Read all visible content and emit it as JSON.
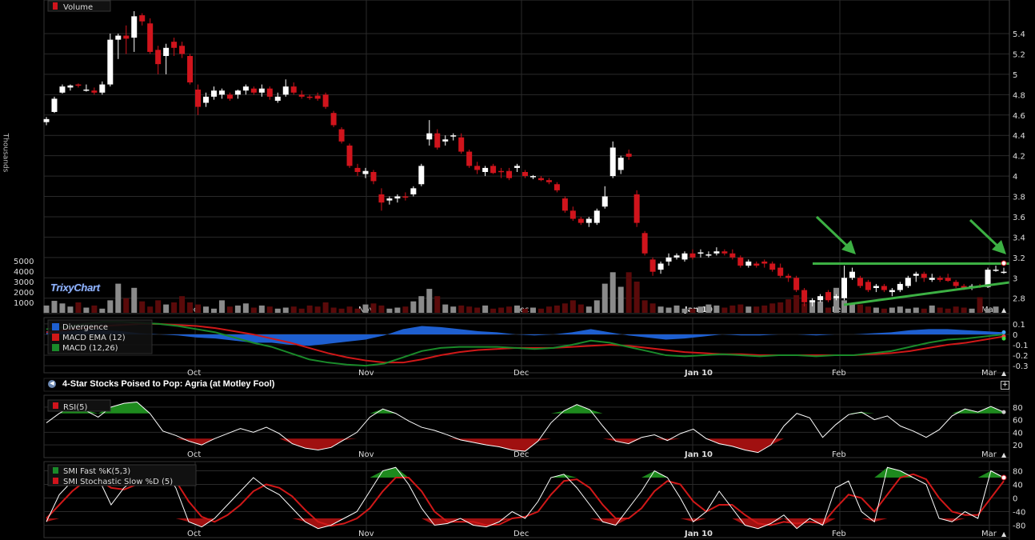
{
  "chart_data": [
    {
      "type": "candlestick",
      "legend": [
        "Volume"
      ],
      "y_ticks": [
        "2.8",
        "3",
        "3.2",
        "3.4",
        "3.6",
        "3.8",
        "4",
        "4.2",
        "4.4",
        "4.6",
        "4.8",
        "5",
        "5.2",
        "5.4"
      ],
      "ylim": [
        2.68,
        5.62
      ],
      "x_labels": [
        "Oct",
        "Nov",
        "Dec",
        "Jan 10",
        "Feb",
        "Mar"
      ],
      "ohlc": [
        [
          4.53,
          4.58,
          4.5,
          4.56
        ],
        [
          4.63,
          4.78,
          4.62,
          4.76
        ],
        [
          4.82,
          4.9,
          4.81,
          4.88
        ],
        [
          4.87,
          4.9,
          4.84,
          4.89
        ],
        [
          4.9,
          4.91,
          4.87,
          4.89
        ],
        [
          4.85,
          4.9,
          4.83,
          4.85
        ],
        [
          4.84,
          4.87,
          4.8,
          4.82
        ],
        [
          4.82,
          4.93,
          4.8,
          4.9
        ],
        [
          4.9,
          5.4,
          4.88,
          5.34
        ],
        [
          5.34,
          5.4,
          5.15,
          5.38
        ],
        [
          5.38,
          5.48,
          5.2,
          5.35
        ],
        [
          5.36,
          5.62,
          5.22,
          5.57
        ],
        [
          5.58,
          5.6,
          5.48,
          5.52
        ],
        [
          5.5,
          5.55,
          5.2,
          5.22
        ],
        [
          5.24,
          5.28,
          5.0,
          5.1
        ],
        [
          5.18,
          5.3,
          5.0,
          5.26
        ],
        [
          5.32,
          5.36,
          5.18,
          5.26
        ],
        [
          5.28,
          5.32,
          5.16,
          5.2
        ],
        [
          5.18,
          5.2,
          4.9,
          4.92
        ],
        [
          4.85,
          4.9,
          4.6,
          4.68
        ],
        [
          4.72,
          4.82,
          4.68,
          4.78
        ],
        [
          4.78,
          4.88,
          4.75,
          4.84
        ],
        [
          4.8,
          4.86,
          4.76,
          4.84
        ],
        [
          4.8,
          4.82,
          4.74,
          4.76
        ],
        [
          4.8,
          4.85,
          4.76,
          4.84
        ],
        [
          4.84,
          4.9,
          4.8,
          4.88
        ],
        [
          4.86,
          4.88,
          4.8,
          4.82
        ],
        [
          4.82,
          4.9,
          4.78,
          4.86
        ],
        [
          4.86,
          4.88,
          4.75,
          4.78
        ],
        [
          4.74,
          4.82,
          4.72,
          4.78
        ],
        [
          4.8,
          4.95,
          4.78,
          4.88
        ],
        [
          4.88,
          4.92,
          4.8,
          4.82
        ],
        [
          4.8,
          4.84,
          4.76,
          4.78
        ],
        [
          4.78,
          4.8,
          4.75,
          4.77
        ],
        [
          4.79,
          4.82,
          4.74,
          4.76
        ],
        [
          4.8,
          4.82,
          4.66,
          4.68
        ],
        [
          4.62,
          4.64,
          4.48,
          4.5
        ],
        [
          4.46,
          4.48,
          4.32,
          4.34
        ],
        [
          4.3,
          4.32,
          4.08,
          4.1
        ],
        [
          4.08,
          4.12,
          4.0,
          4.04
        ],
        [
          4.02,
          4.08,
          3.98,
          4.05
        ],
        [
          4.04,
          4.06,
          3.92,
          3.95
        ],
        [
          3.82,
          3.88,
          3.66,
          3.74
        ],
        [
          3.76,
          3.8,
          3.72,
          3.78
        ],
        [
          3.78,
          3.82,
          3.74,
          3.8
        ],
        [
          3.8,
          3.84,
          3.76,
          3.79
        ],
        [
          3.82,
          3.9,
          3.8,
          3.88
        ],
        [
          3.92,
          4.12,
          3.9,
          4.1
        ],
        [
          4.36,
          4.55,
          4.3,
          4.42
        ],
        [
          4.42,
          4.46,
          4.26,
          4.28
        ],
        [
          4.34,
          4.4,
          4.3,
          4.36
        ],
        [
          4.4,
          4.42,
          4.35,
          4.4
        ],
        [
          4.38,
          4.42,
          4.22,
          4.24
        ],
        [
          4.24,
          4.26,
          4.08,
          4.1
        ],
        [
          4.1,
          4.14,
          4.02,
          4.06
        ],
        [
          4.04,
          4.1,
          4.0,
          4.08
        ],
        [
          4.1,
          4.12,
          4.02,
          4.03
        ],
        [
          4.05,
          4.08,
          3.98,
          4.04
        ],
        [
          4.05,
          4.08,
          3.96,
          3.98
        ],
        [
          4.08,
          4.12,
          4.04,
          4.1
        ],
        [
          4.04,
          4.06,
          3.98,
          4.0
        ],
        [
          3.99,
          4.01,
          3.97,
          4.0
        ],
        [
          3.98,
          4.0,
          3.95,
          3.96
        ],
        [
          3.96,
          3.98,
          3.92,
          3.94
        ],
        [
          3.92,
          3.94,
          3.84,
          3.86
        ],
        [
          3.78,
          3.8,
          3.64,
          3.66
        ],
        [
          3.66,
          3.7,
          3.56,
          3.58
        ],
        [
          3.58,
          3.6,
          3.52,
          3.54
        ],
        [
          3.54,
          3.6,
          3.5,
          3.58
        ],
        [
          3.54,
          3.68,
          3.52,
          3.66
        ],
        [
          3.7,
          3.9,
          3.68,
          3.8
        ],
        [
          4.0,
          4.34,
          3.98,
          4.28
        ],
        [
          4.06,
          4.2,
          4.02,
          4.18
        ],
        [
          4.22,
          4.26,
          4.16,
          4.19
        ],
        [
          3.82,
          3.86,
          3.5,
          3.54
        ],
        [
          3.44,
          3.46,
          3.22,
          3.24
        ],
        [
          3.18,
          3.2,
          3.02,
          3.06
        ],
        [
          3.08,
          3.16,
          3.04,
          3.14
        ],
        [
          3.16,
          3.24,
          3.12,
          3.2
        ],
        [
          3.2,
          3.24,
          3.18,
          3.22
        ],
        [
          3.18,
          3.26,
          3.16,
          3.24
        ],
        [
          3.24,
          3.28,
          3.18,
          3.2
        ],
        [
          3.24,
          3.28,
          3.2,
          3.25
        ],
        [
          3.22,
          3.26,
          3.2,
          3.23
        ],
        [
          3.24,
          3.3,
          3.22,
          3.26
        ],
        [
          3.26,
          3.28,
          3.22,
          3.24
        ],
        [
          3.24,
          3.28,
          3.18,
          3.2
        ],
        [
          3.2,
          3.22,
          3.1,
          3.12
        ],
        [
          3.12,
          3.18,
          3.1,
          3.16
        ],
        [
          3.14,
          3.16,
          3.1,
          3.12
        ],
        [
          3.16,
          3.18,
          3.1,
          3.14
        ],
        [
          3.14,
          3.16,
          3.06,
          3.08
        ],
        [
          3.1,
          3.14,
          3.0,
          3.02
        ],
        [
          3.02,
          3.04,
          2.96,
          3.0
        ],
        [
          3.0,
          3.02,
          2.86,
          2.88
        ],
        [
          2.88,
          2.9,
          2.72,
          2.76
        ],
        [
          2.76,
          2.8,
          2.72,
          2.78
        ],
        [
          2.78,
          2.84,
          2.76,
          2.82
        ],
        [
          2.86,
          2.88,
          2.76,
          2.78
        ],
        [
          2.8,
          2.84,
          2.78,
          2.82
        ],
        [
          2.8,
          3.12,
          2.78,
          3.0
        ],
        [
          3.0,
          3.1,
          2.98,
          3.06
        ],
        [
          3.0,
          3.02,
          2.9,
          2.92
        ],
        [
          2.96,
          2.98,
          2.86,
          2.88
        ],
        [
          2.9,
          2.94,
          2.86,
          2.92
        ],
        [
          2.92,
          2.94,
          2.86,
          2.88
        ],
        [
          2.86,
          2.9,
          2.82,
          2.88
        ],
        [
          2.88,
          2.96,
          2.86,
          2.94
        ],
        [
          2.92,
          3.02,
          2.9,
          3.0
        ],
        [
          3.02,
          3.06,
          2.96,
          3.04
        ],
        [
          3.04,
          3.06,
          2.96,
          3.0
        ],
        [
          2.98,
          3.04,
          2.96,
          3.0
        ],
        [
          3.0,
          3.02,
          2.96,
          2.98
        ],
        [
          3.0,
          3.04,
          2.96,
          2.97
        ],
        [
          2.96,
          2.98,
          2.9,
          2.92
        ],
        [
          2.92,
          2.94,
          2.88,
          2.9
        ],
        [
          2.9,
          2.94,
          2.88,
          2.92
        ],
        [
          2.92,
          2.94,
          2.9,
          2.91
        ],
        [
          2.91,
          3.1,
          2.9,
          3.08
        ],
        [
          3.08,
          3.12,
          3.06,
          3.08
        ],
        [
          3.06,
          3.1,
          3.04,
          3.06
        ]
      ],
      "volume_ticks": [
        "1000",
        "2000",
        "3000",
        "4000",
        "5000"
      ],
      "volume": [
        700,
        1150,
        900,
        600,
        1000,
        500,
        700,
        400,
        1200,
        2800,
        1400,
        2400,
        1100,
        600,
        1200,
        800,
        1000,
        1600,
        1000,
        800,
        600,
        400,
        1200,
        600,
        700,
        900,
        500,
        700,
        600,
        400,
        500,
        600,
        400,
        700,
        600,
        1000,
        500,
        400,
        600,
        400,
        800,
        900,
        700,
        400,
        500,
        600,
        1100,
        1600,
        2300,
        1600,
        800,
        600,
        700,
        600,
        500,
        700,
        400,
        500,
        600,
        700,
        400,
        500,
        400,
        600,
        700,
        900,
        1200,
        800,
        600,
        1200,
        2800,
        3900,
        2500,
        3900,
        3000,
        1200,
        900,
        600,
        500,
        700,
        400,
        400,
        600,
        800,
        700,
        500,
        700,
        800,
        600,
        600,
        700,
        900,
        1000,
        1300,
        1700,
        900,
        1200,
        1100,
        500,
        2400,
        1200,
        900,
        800,
        600,
        500,
        400,
        500,
        600,
        400,
        500,
        400,
        700,
        500,
        400,
        600,
        500,
        400,
        1500,
        400,
        600
      ],
      "annotations": {
        "resistance_level": 3.14
      }
    },
    {
      "type": "line",
      "name": "MACD",
      "series": [
        {
          "name": "Divergence",
          "color": "#1e5fd0"
        },
        {
          "name": "MACD EMA (12)",
          "color": "#d01818"
        },
        {
          "name": "MACD (12,26)",
          "color": "#1a8a2a"
        }
      ],
      "y_ticks": [
        "0.1",
        "0",
        "-0.1",
        "-0.2",
        "-0.3"
      ],
      "ylim": [
        -0.33,
        0.13
      ],
      "macd": [
        0.05,
        0.07,
        0.1,
        0.12,
        0.12,
        0.11,
        0.1,
        0.08,
        0.05,
        0.02,
        -0.03,
        -0.08,
        -0.12,
        -0.18,
        -0.24,
        -0.27,
        -0.29,
        -0.3,
        -0.28,
        -0.22,
        -0.16,
        -0.13,
        -0.12,
        -0.12,
        -0.12,
        -0.13,
        -0.14,
        -0.13,
        -0.1,
        -0.06,
        -0.08,
        -0.12,
        -0.16,
        -0.2,
        -0.21,
        -0.2,
        -0.19,
        -0.2,
        -0.21,
        -0.2,
        -0.2,
        -0.21,
        -0.2,
        -0.2,
        -0.18,
        -0.16,
        -0.12,
        -0.08,
        -0.05,
        -0.04,
        -0.02,
        0.0
      ],
      "signal": [
        0.02,
        0.04,
        0.06,
        0.08,
        0.09,
        0.1,
        0.1,
        0.09,
        0.08,
        0.06,
        0.03,
        0.0,
        -0.04,
        -0.08,
        -0.13,
        -0.18,
        -0.22,
        -0.25,
        -0.27,
        -0.27,
        -0.24,
        -0.2,
        -0.17,
        -0.15,
        -0.14,
        -0.13,
        -0.13,
        -0.13,
        -0.12,
        -0.11,
        -0.1,
        -0.11,
        -0.13,
        -0.15,
        -0.17,
        -0.18,
        -0.19,
        -0.19,
        -0.2,
        -0.2,
        -0.2,
        -0.2,
        -0.2,
        -0.2,
        -0.19,
        -0.18,
        -0.16,
        -0.13,
        -0.1,
        -0.08,
        -0.05,
        -0.02
      ],
      "divergence": [
        0.03,
        0.03,
        0.04,
        0.04,
        0.03,
        0.01,
        0.0,
        -0.01,
        -0.03,
        -0.04,
        -0.06,
        -0.08,
        -0.08,
        -0.1,
        -0.11,
        -0.09,
        -0.07,
        -0.05,
        -0.01,
        0.05,
        0.08,
        0.07,
        0.05,
        0.03,
        0.02,
        0.0,
        -0.01,
        0.0,
        0.02,
        0.05,
        0.02,
        -0.01,
        -0.03,
        -0.05,
        -0.04,
        -0.02,
        0.0,
        -0.01,
        -0.01,
        0.0,
        0.0,
        -0.01,
        0.0,
        0.0,
        0.01,
        0.02,
        0.04,
        0.05,
        0.05,
        0.04,
        0.03,
        0.02
      ]
    },
    {
      "type": "line",
      "name": "RSI",
      "series": [
        {
          "name": "RSI(5)",
          "color": "#ffffff"
        }
      ],
      "y_ticks": [
        "80",
        "60",
        "40",
        "20"
      ],
      "ylim": [
        5,
        95
      ],
      "values": [
        55,
        70,
        82,
        75,
        64,
        80,
        86,
        88,
        70,
        42,
        35,
        26,
        20,
        30,
        38,
        46,
        40,
        48,
        38,
        22,
        15,
        12,
        16,
        28,
        40,
        64,
        77,
        70,
        58,
        48,
        43,
        36,
        28,
        24,
        20,
        17,
        12,
        10,
        26,
        55,
        74,
        84,
        76,
        50,
        26,
        22,
        32,
        36,
        27,
        38,
        45,
        30,
        22,
        18,
        12,
        8,
        20,
        50,
        70,
        63,
        32,
        52,
        68,
        72,
        60,
        66,
        50,
        42,
        32,
        44,
        66,
        77,
        72,
        81,
        72
      ]
    },
    {
      "type": "line",
      "name": "SMI",
      "series": [
        {
          "name": "SMI Fast %K(5,3)",
          "color": "#ffffff"
        },
        {
          "name": "SMI Stochastic Slow %D (5)",
          "color": "#d01818"
        }
      ],
      "y_ticks": [
        "80",
        "40",
        "0",
        "-40",
        "-80"
      ],
      "ylim": [
        -100,
        100
      ],
      "k": [
        -70,
        10,
        50,
        80,
        60,
        -20,
        30,
        60,
        80,
        85,
        30,
        -70,
        -85,
        -60,
        -20,
        20,
        60,
        30,
        10,
        -30,
        -70,
        -90,
        -80,
        -60,
        -40,
        20,
        80,
        90,
        40,
        -30,
        -80,
        -75,
        -60,
        -80,
        -85,
        -70,
        -40,
        -60,
        -10,
        60,
        70,
        30,
        -20,
        -70,
        -80,
        -30,
        20,
        80,
        60,
        0,
        -70,
        -40,
        20,
        -30,
        -80,
        -90,
        -75,
        -50,
        -90,
        -60,
        -80,
        30,
        50,
        -40,
        -70,
        90,
        80,
        60,
        40,
        -60,
        -70,
        -40,
        -60,
        80,
        60
      ],
      "d": [
        -60,
        -20,
        20,
        50,
        55,
        30,
        25,
        40,
        60,
        70,
        50,
        -10,
        -55,
        -70,
        -50,
        -20,
        20,
        40,
        30,
        5,
        -35,
        -70,
        -82,
        -75,
        -60,
        -30,
        20,
        60,
        60,
        20,
        -40,
        -70,
        -70,
        -70,
        -80,
        -78,
        -60,
        -55,
        -40,
        10,
        50,
        55,
        30,
        -20,
        -60,
        -60,
        -30,
        20,
        50,
        40,
        -10,
        -40,
        -20,
        -20,
        -50,
        -75,
        -80,
        -70,
        -75,
        -70,
        -75,
        -30,
        10,
        0,
        -40,
        10,
        60,
        70,
        55,
        0,
        -40,
        -50,
        -50,
        0,
        50
      ]
    }
  ],
  "labels": {
    "volume_legend": "Volume",
    "thousands": "Thousands",
    "logo": "TrixyChart",
    "news_title": "4-Star Stocks Poised to Pop: Agria (at Motley Fool)",
    "plus": "+",
    "rsi_legend": "RSI(5)",
    "smi_legend_1": "SMI Fast %K(5,3)",
    "smi_legend_2": "SMI Stochastic Slow %D (5)",
    "macd_legend_1": "Divergence",
    "macd_legend_2": "MACD EMA (12)",
    "macd_legend_3": "MACD (12,26)"
  },
  "colors": {
    "up": "#ffffff",
    "down": "#d0141c",
    "volume_bar": "#8a8a8a",
    "volume_bar_down": "#5a0a0a",
    "annotation": "#3cb043",
    "grid": "#2a2a2a",
    "overbought_fill": "#1e8a1e",
    "oversold_fill": "#a01010"
  }
}
